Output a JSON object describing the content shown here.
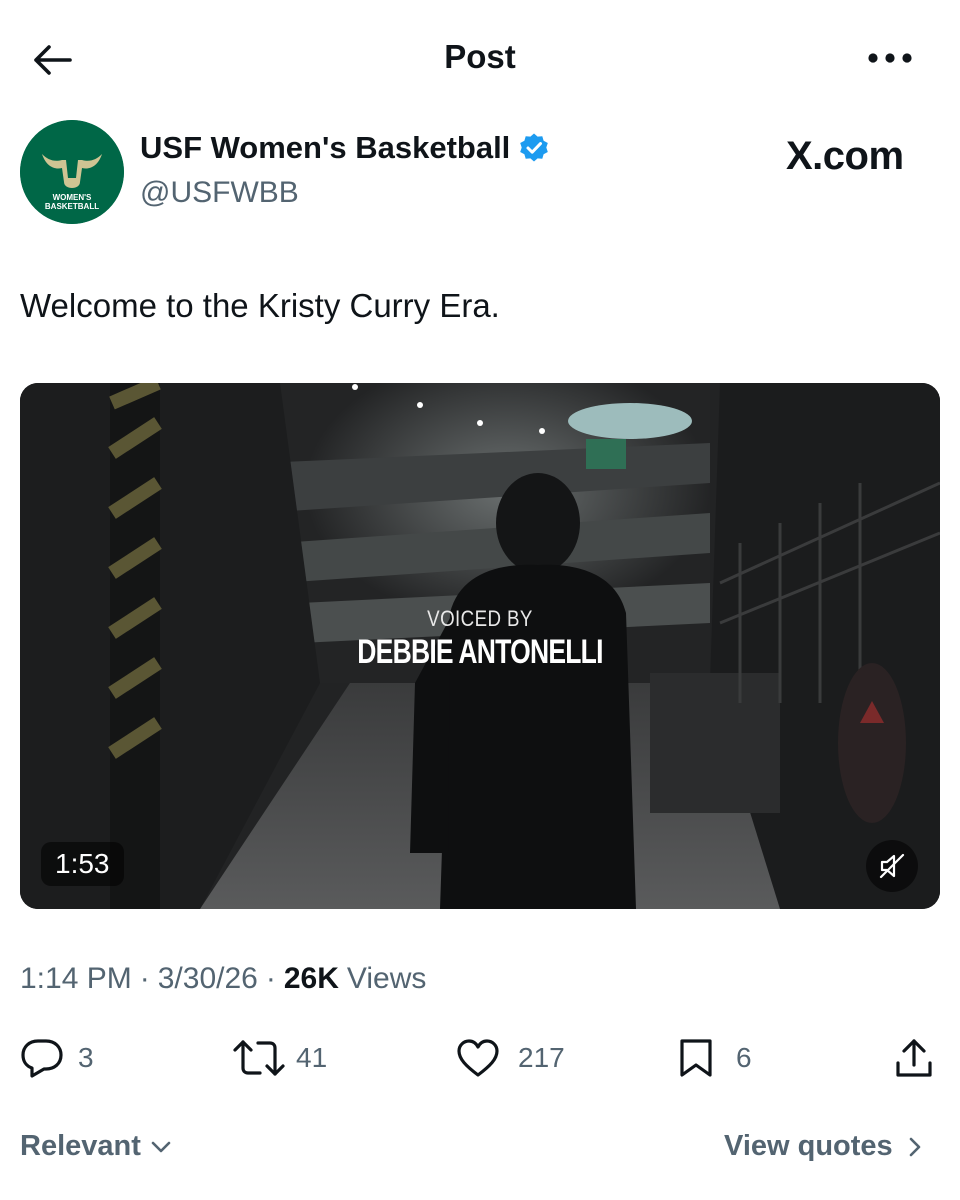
{
  "header": {
    "title": "Post",
    "back_icon": "arrow-left-icon",
    "more_icon": "more-horizontal-icon"
  },
  "author": {
    "name": "USF Women's Basketball",
    "handle": "@USFWBB",
    "verified": true,
    "avatar_text": "WOMEN'S\nBASKETBALL"
  },
  "watermark": "X.com",
  "post": {
    "text": "Welcome to the Kristy Curry Era."
  },
  "media": {
    "overlay_line1": "VOICED BY",
    "overlay_line2": "DEBBIE ANTONELLI",
    "duration": "1:53",
    "mute_icon": "sound-off-icon"
  },
  "meta": {
    "time": "1:14 PM",
    "separator": "·",
    "date": "3/30/26",
    "views_count": "26K",
    "views_label": "Views"
  },
  "actions": {
    "replies": "3",
    "reposts": "41",
    "likes": "217",
    "bookmarks": "6"
  },
  "footer": {
    "sort_label": "Relevant",
    "view_quotes_label": "View quotes"
  },
  "colors": {
    "text_primary": "#0f1419",
    "text_secondary": "#536471",
    "verified_blue": "#1d9bf0",
    "usf_green": "#006747",
    "usf_gold": "#cfc493"
  }
}
